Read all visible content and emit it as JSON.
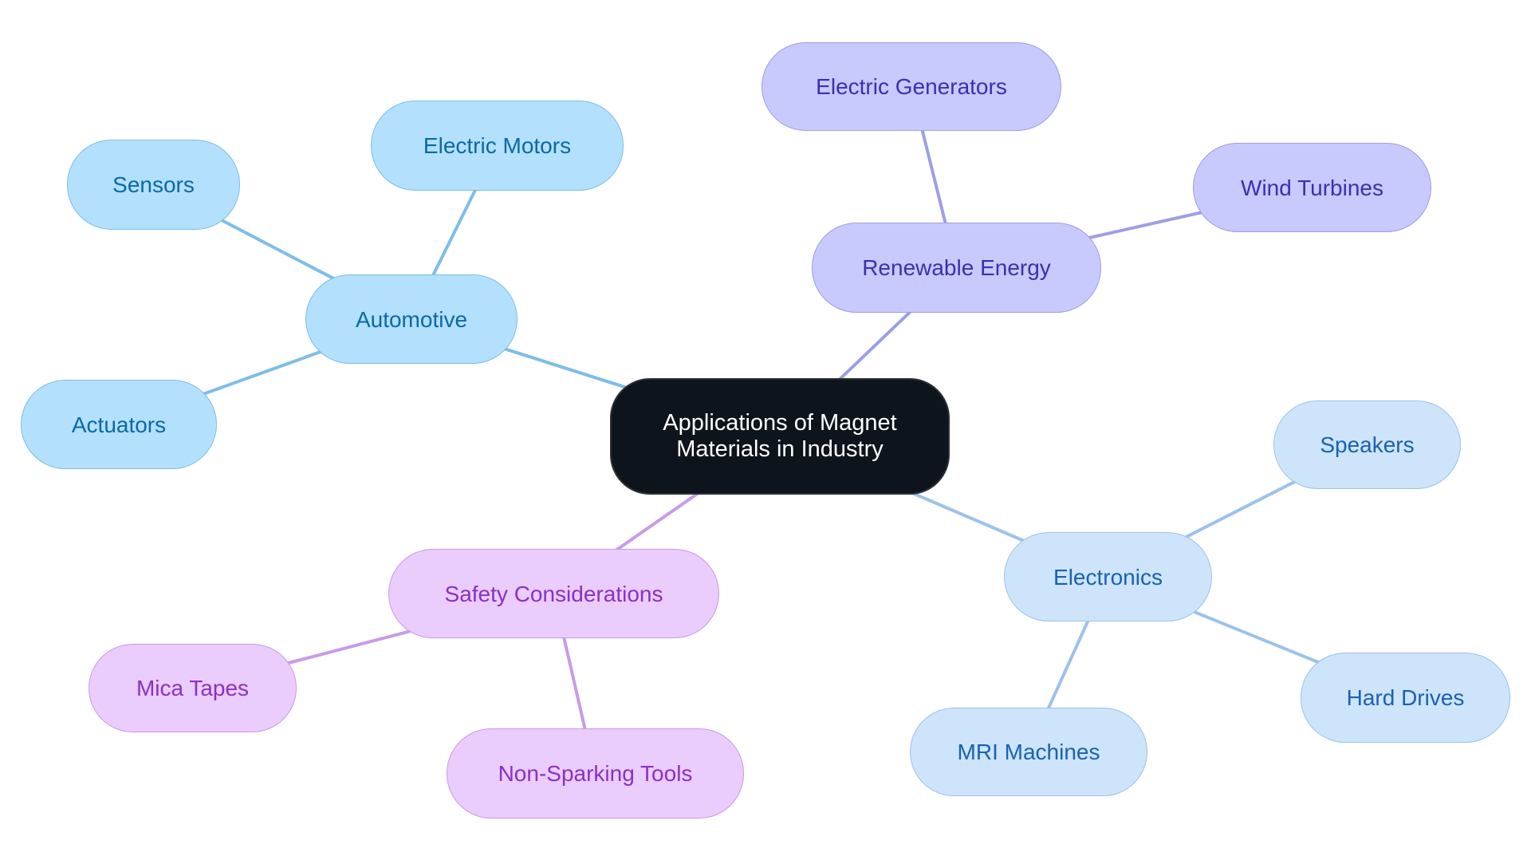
{
  "diagram": {
    "type": "mindmap",
    "root": {
      "id": "root",
      "label": "Applications of Magnet\nMaterials in Industry",
      "colors": {
        "fill": "#0d141b",
        "stroke": "#2b3138",
        "text": "#ffffff"
      }
    },
    "branches": [
      {
        "id": "automotive",
        "label": "Automotive",
        "colors": {
          "fill": "#b3e0fd",
          "stroke": "#7fbde8",
          "text": "#0a6aa6",
          "edge": "#7fbde8"
        },
        "children": [
          {
            "id": "electric-motors",
            "label": "Electric Motors"
          },
          {
            "id": "sensors",
            "label": "Sensors"
          },
          {
            "id": "actuators",
            "label": "Actuators"
          }
        ]
      },
      {
        "id": "renewable-energy",
        "label": "Renewable Energy",
        "colors": {
          "fill": "#c8c9fd",
          "stroke": "#9d9ee6",
          "text": "#3a31b0",
          "edge": "#9d9ee6"
        },
        "children": [
          {
            "id": "electric-generators",
            "label": "Electric Generators"
          },
          {
            "id": "wind-turbines",
            "label": "Wind Turbines"
          }
        ]
      },
      {
        "id": "electronics",
        "label": "Electronics",
        "colors": {
          "fill": "#cde4fb",
          "stroke": "#9cc2ea",
          "text": "#1a62b0",
          "edge": "#9cc2ea"
        },
        "children": [
          {
            "id": "speakers",
            "label": "Speakers"
          },
          {
            "id": "hard-drives",
            "label": "Hard Drives"
          },
          {
            "id": "mri-machines",
            "label": "MRI Machines"
          }
        ]
      },
      {
        "id": "safety-considerations",
        "label": "Safety Considerations",
        "colors": {
          "fill": "#eaccfd",
          "stroke": "#c89be9",
          "text": "#8a31c4",
          "edge": "#c89be9"
        },
        "children": [
          {
            "id": "mica-tapes",
            "label": "Mica Tapes"
          },
          {
            "id": "non-sparking-tools",
            "label": "Non-Sparking Tools"
          }
        ]
      }
    ]
  }
}
